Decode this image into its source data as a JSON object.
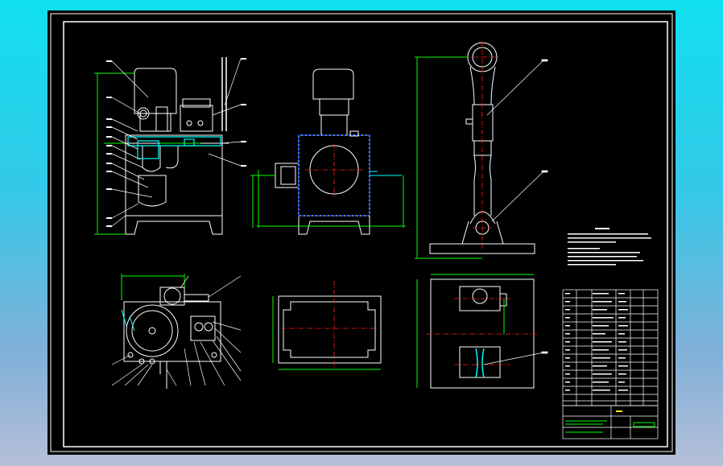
{
  "drawing": {
    "colors": {
      "frame": "#ffffff",
      "part": "#ffffff",
      "dimension": "#00ff00",
      "centerline": "#ff2020",
      "leader": "#ffffff",
      "section": "#0044ff",
      "highlight": "#00ffff",
      "accent": "#ffff00"
    },
    "title_block": {
      "grid_cols": 5,
      "grid_rows": 14
    }
  }
}
